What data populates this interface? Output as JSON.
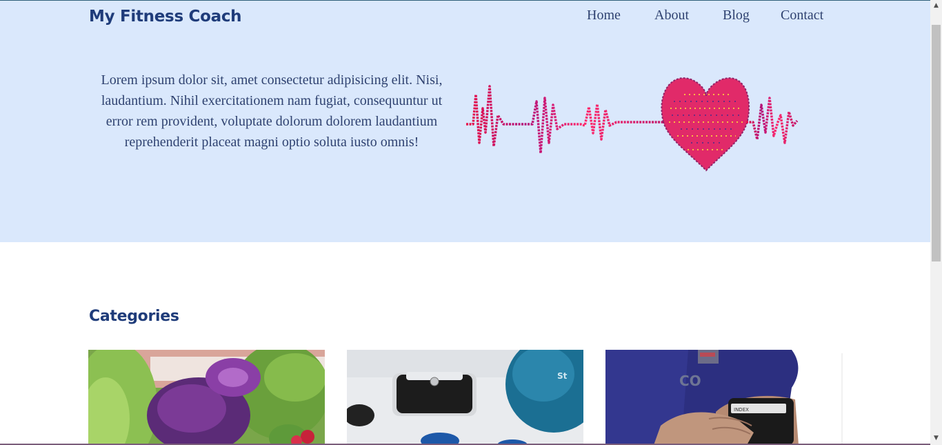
{
  "brand": {
    "title": "My Fitness Coach"
  },
  "nav": {
    "items": [
      "Home",
      "About",
      "Blog",
      "Contact"
    ]
  },
  "hero": {
    "text": "Lorem ipsum dolor sit, amet consectetur adipisicing elit. Nisi, laudantium. Nihil exercitationem nam fugiat, consequuntur ut error rem provident, voluptate dolorum dolorem laudantium reprehenderit placeat magni optio soluta iusto omnis!",
    "image": "heartbeat-heart-illustration"
  },
  "categories": {
    "title": "Categories",
    "cards": [
      {
        "image": "vegetables-photo"
      },
      {
        "image": "scale-and-dumbbells-photo"
      },
      {
        "image": "blood-pressure-cuff-photo"
      }
    ]
  },
  "colors": {
    "hero_bg": "#dae8fc",
    "brand": "#1f3c7a",
    "text": "#2f4270"
  },
  "scrollbar": {
    "up_arrow": "▲",
    "down_arrow": "▼"
  }
}
